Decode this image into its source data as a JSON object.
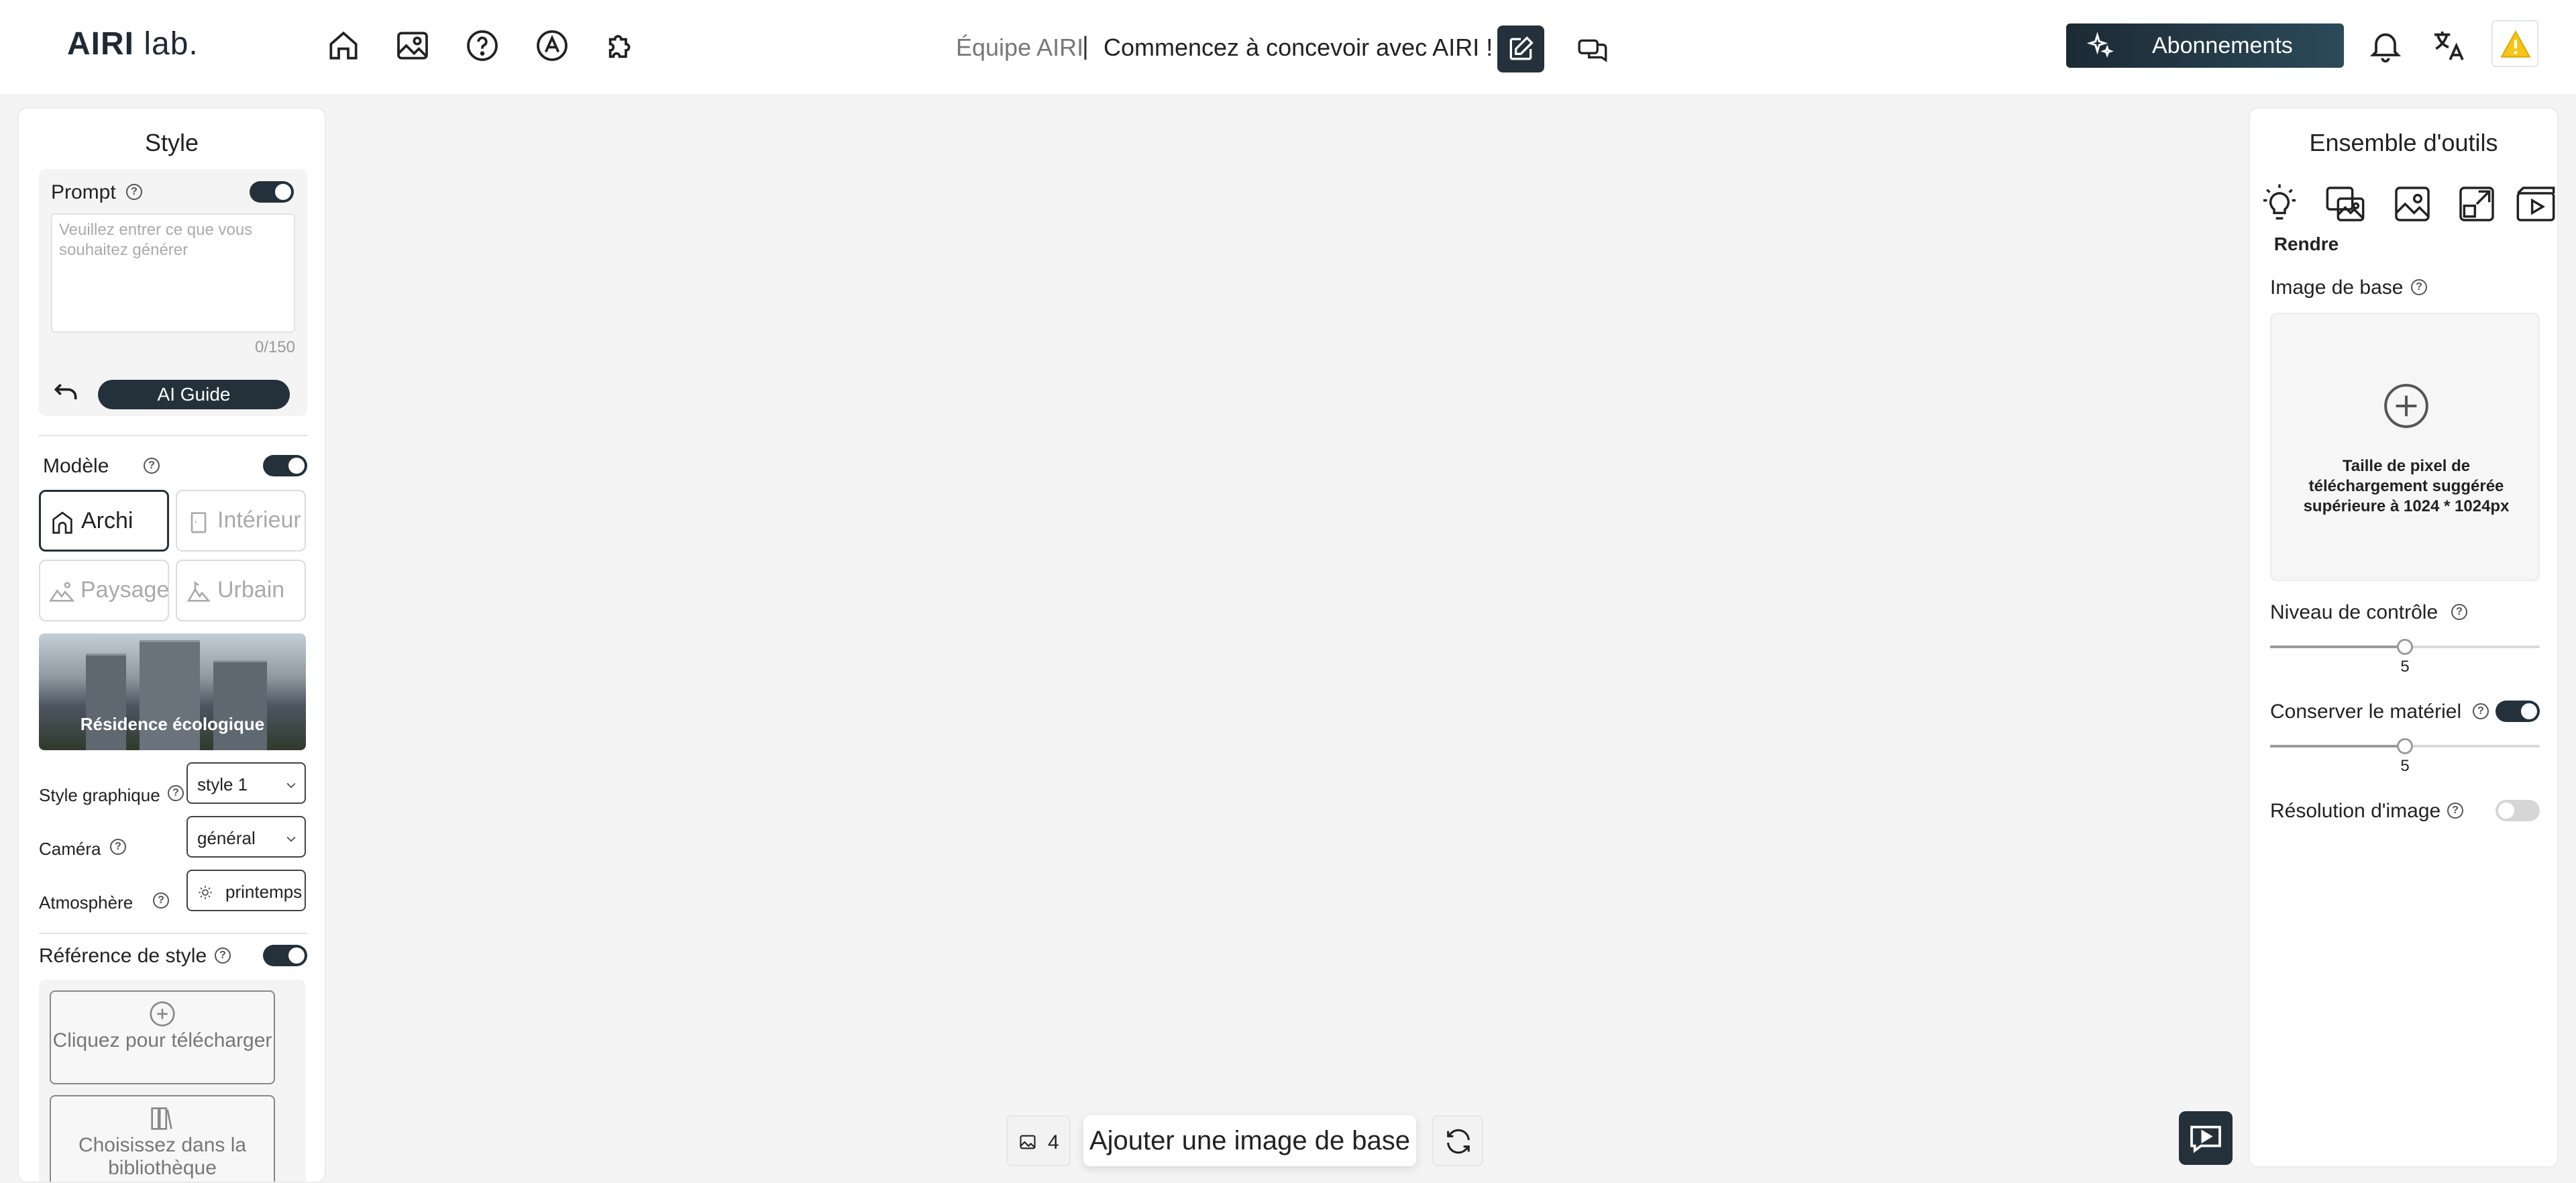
{
  "header": {
    "logo_bold": "AIRI",
    "logo_light": " lab.",
    "team": "Équipe AIRI",
    "separator": "|",
    "headline": "Commencez à concevoir avec AIRI !",
    "subscriptions_label": "Abonnements",
    "nav_icons": [
      "home-icon",
      "gallery-icon",
      "help-icon",
      "ai-icon",
      "plugin-icon"
    ]
  },
  "left_panel": {
    "title": "Style",
    "prompt": {
      "label": "Prompt",
      "placeholder": "Veuillez entrer ce que vous souhaitez générer",
      "counter": "0/150",
      "ai_guide_label": "AI Guide",
      "enabled": true
    },
    "model": {
      "label": "Modèle",
      "enabled": true,
      "options": [
        {
          "label": "Archi",
          "icon": "arch-icon",
          "active": true
        },
        {
          "label": "Intérieur",
          "icon": "interior-icon",
          "active": false
        },
        {
          "label": "Paysage",
          "icon": "landscape-icon",
          "active": false
        },
        {
          "label": "Urbain",
          "icon": "urban-icon",
          "active": false
        }
      ],
      "style_card_label": "Résidence écologique"
    },
    "graphic_style": {
      "label": "Style graphique",
      "value": "style 1"
    },
    "camera": {
      "label": "Caméra",
      "value": "général"
    },
    "atmosphere": {
      "label": "Atmosphère",
      "value": "printemps"
    },
    "style_reference": {
      "label": "Référence de style",
      "enabled": true,
      "upload_label": "Cliquez pour télécharger",
      "library_label": "Choisissez dans la bibliothèque"
    }
  },
  "canvas": {
    "image_count": "4",
    "add_base_label": "Ajouter une image de base"
  },
  "right_panel": {
    "title": "Ensemble d'outils",
    "tools": [
      "bulb-icon",
      "render-icon",
      "image-icon",
      "expand-icon",
      "video-icon"
    ],
    "active_tool_label": "Rendre",
    "base_image": {
      "label": "Image de base",
      "hint": "Taille de pixel de téléchargement suggérée supérieure à 1024 * 1024px"
    },
    "control_level": {
      "label": "Niveau de contrôle",
      "value": "5",
      "fraction": 0.5
    },
    "keep_material": {
      "label": "Conserver le matériel",
      "value": "5",
      "fraction": 0.5,
      "enabled": true
    },
    "image_resolution": {
      "label": "Résolution d'image",
      "enabled": false
    }
  },
  "colors": {
    "dark": "#24313a",
    "accent_warning": "#f5c518",
    "background": "#f4f4f4"
  }
}
